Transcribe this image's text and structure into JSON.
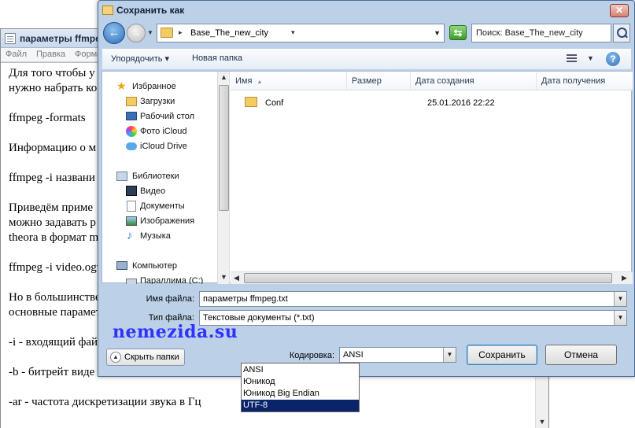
{
  "notepad": {
    "title": "параметры ffmpeg",
    "menu": [
      "Файл",
      "Правка",
      "Форма"
    ],
    "lines": [
      {
        "text": "Для того чтобы у",
        "y": 0
      },
      {
        "text": "нужно набрать ко",
        "y": 0
      },
      {
        "text": "ffmpeg -formats",
        "y": 0
      },
      {
        "text": "Информацию о м",
        "y": 0
      },
      {
        "text": "ffmpeg -i названи",
        "y": 0
      },
      {
        "text": "Приведём приме",
        "y": 0
      },
      {
        "text": "можно задавать р",
        "y": 0
      },
      {
        "text": "theora в формат m",
        "y": 0
      },
      {
        "text": "ffmpeg -i video.ogv",
        "y": 0
      },
      {
        "text": "Но в большинстве",
        "y": 0
      },
      {
        "text": "основные парамет",
        "y": 0
      },
      {
        "text": "-i - входящий фай",
        "y": 0
      },
      {
        "text": "-b - битрейт виде",
        "y": 0
      },
      {
        "text": "-ar - частота дискретизации звука в Гц",
        "y": 0
      }
    ]
  },
  "dialog": {
    "title": "Сохранить как",
    "close_label": "✕",
    "breadcrumb": "Base_The_new_city",
    "search_placeholder": "Поиск: Base_The_new_city",
    "toolbar": {
      "organize": "Упорядочить ▾",
      "new_folder": "Новая папка"
    },
    "navpane": [
      {
        "label": "Избранное",
        "icon": "star-icon",
        "cls": "star",
        "indent": false
      },
      {
        "label": "Загрузки",
        "icon": "downloads-folder-icon",
        "cls": "folder",
        "indent": true
      },
      {
        "label": "Рабочий стол",
        "icon": "desktop-icon",
        "cls": "desktop",
        "indent": true
      },
      {
        "label": "Фото iCloud",
        "icon": "icloud-photos-icon",
        "cls": "photo",
        "indent": true
      },
      {
        "label": "iCloud Drive",
        "icon": "icloud-drive-icon",
        "cls": "cloud",
        "indent": true
      },
      {
        "label": "Библиотеки",
        "icon": "libraries-icon",
        "cls": "lib",
        "indent": false
      },
      {
        "label": "Видео",
        "icon": "video-icon",
        "cls": "video",
        "indent": true
      },
      {
        "label": "Документы",
        "icon": "documents-icon",
        "cls": "doc",
        "indent": true
      },
      {
        "label": "Изображения",
        "icon": "pictures-icon",
        "cls": "image",
        "indent": true
      },
      {
        "label": "Музыка",
        "icon": "music-icon",
        "cls": "music",
        "indent": true
      },
      {
        "label": "Компьютер",
        "icon": "computer-icon",
        "cls": "pc",
        "indent": false
      },
      {
        "label": "Параллима (С:)",
        "icon": "drive-icon",
        "cls": "drive",
        "indent": true
      }
    ],
    "columns": [
      "Имя",
      "Размер",
      "Дата создания",
      "Дата получения"
    ],
    "files": [
      {
        "name": "Conf",
        "size": "",
        "created": "25.01.2016 22:22"
      }
    ],
    "filename_label": "Имя файла:",
    "filename_value": "параметры ffmpeg.txt",
    "filetype_label": "Тип файла:",
    "filetype_value": "Текстовые документы (*.txt)",
    "hide_folders": "Скрыть папки",
    "encoding_label": "Кодировка:",
    "encoding_value": "ANSI",
    "encoding_options": [
      "ANSI",
      "Юникод",
      "Юникод Big Endian",
      "UTF-8"
    ],
    "encoding_highlighted": "UTF-8",
    "save_label": "Сохранить",
    "cancel_label": "Отмена"
  },
  "watermark": "nemezida.su",
  "colors": {
    "dialog_frame": "#bcd0e8",
    "selection": "#0a246a",
    "watermark": "#3030ff"
  }
}
